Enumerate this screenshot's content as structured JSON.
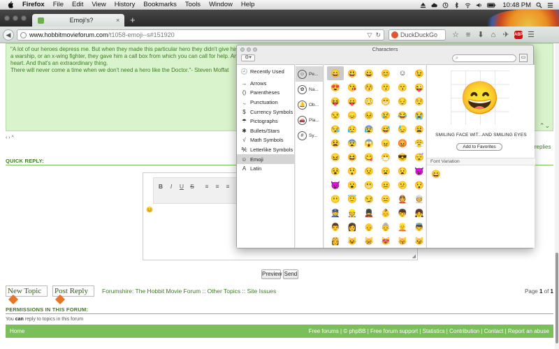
{
  "menubar": {
    "app": "Firefox",
    "items": [
      "File",
      "Edit",
      "View",
      "History",
      "Bookmarks",
      "Tools",
      "Window",
      "Help"
    ],
    "clock": "10:48 PM"
  },
  "browser": {
    "tab_title": "Emoji's?",
    "url_host": "www.hobbitmovieforum.com",
    "url_path": "/t1058-emoji--s#151920",
    "search_engine": "DuckDuckGo"
  },
  "page": {
    "quote_line1": "\"A lot of our heroes depress me. But when they made this particular hero they didn't give him a gun, they gave him a screwdriver to fix things. They didn't give him a tank, or",
    "quote_line2": "a warship, or an x-wing fighter, they gave him a call box from which you can call for help. And they didn't",
    "quote_line3": "heart. And that's an extraordinary thing.",
    "quote_line4": "There will never come a time when we don't need a hero like the Doctor.\"- Steven Moffat",
    "reply_link": "r replies",
    "quick_reply_title": "QUICK REPLY:",
    "editor_content": "😊",
    "preview_label": "Preview",
    "send_label": "Send",
    "new_topic_label": "New Topic",
    "post_reply_label": "Post Reply",
    "crumb_forum": "Forumshire: The Hobbit Movie Forum",
    "crumb_sep": "::",
    "crumb_other": "Other Topics",
    "crumb_site": "Site Issues",
    "page_label": "Page",
    "page_current": "1",
    "page_of": "of",
    "page_total": "1",
    "permissions_title": "PERMISSIONS IN THIS FORUM:",
    "perm_you": "You",
    "perm_can": "can",
    "perm_rest": "reply to topics in this forum",
    "footer_home": "Home",
    "footer_links": "Free forums | © phpBB | Free forum support | Statistics | Contribution | Contact | Report an abuse"
  },
  "charwin": {
    "title": "Characters",
    "categories": [
      {
        "icon": "🕘",
        "label": "Recently Used"
      },
      {
        "icon": "→",
        "label": "Arrows"
      },
      {
        "icon": "()",
        "label": "Parentheses"
      },
      {
        "icon": ".,",
        "label": "Punctuation"
      },
      {
        "icon": "$",
        "label": "Currency Symbols"
      },
      {
        "icon": "☂",
        "label": "Pictographs"
      },
      {
        "icon": "✱",
        "label": "Bullets/Stars"
      },
      {
        "icon": "√",
        "label": "Math Symbols"
      },
      {
        "icon": "℀",
        "label": "Letterlike Symbols"
      },
      {
        "icon": "☺",
        "label": "Emoji"
      },
      {
        "icon": "A",
        "label": "Latin"
      }
    ],
    "subcategories": [
      {
        "icon": "☺",
        "label": "Pe..."
      },
      {
        "icon": "✿",
        "label": "Na..."
      },
      {
        "icon": "🔔",
        "label": "Ob..."
      },
      {
        "icon": "🚗",
        "label": "Pla..."
      },
      {
        "icon": "#",
        "label": "Sy..."
      }
    ],
    "emojis": [
      "😄",
      "😃",
      "😀",
      "😊",
      "☺",
      "😉",
      "😍",
      "😘",
      "😚",
      "😗",
      "😙",
      "😜",
      "😝",
      "😛",
      "😳",
      "😁",
      "😔",
      "😌",
      "😒",
      "😞",
      "😣",
      "😢",
      "😂",
      "😭",
      "😪",
      "😥",
      "😰",
      "😅",
      "😓",
      "😩",
      "😫",
      "😨",
      "😱",
      "😠",
      "😡",
      "😤",
      "😖",
      "😆",
      "😋",
      "😷",
      "😎",
      "😴",
      "😵",
      "😲",
      "😟",
      "😦",
      "😧",
      "😈",
      "👿",
      "😮",
      "😬",
      "😐",
      "😕",
      "😯",
      "😶",
      "😇",
      "😏",
      "😑",
      "👲",
      "👳",
      "👮",
      "👷",
      "💂",
      "👶",
      "👦",
      "👧",
      "👨",
      "👩",
      "👴",
      "👵",
      "👱",
      "👼",
      "👸",
      "😺",
      "😸",
      "😻",
      "😽",
      "😼"
    ],
    "selected_name": "SMILING FACE WIT...AND SMILING EYES",
    "preview_glyph": "😄",
    "fav_label": "Add to Favorites",
    "font_variation_title": "Font Variation",
    "variation_glyph": "😄",
    "search_placeholder": ""
  }
}
